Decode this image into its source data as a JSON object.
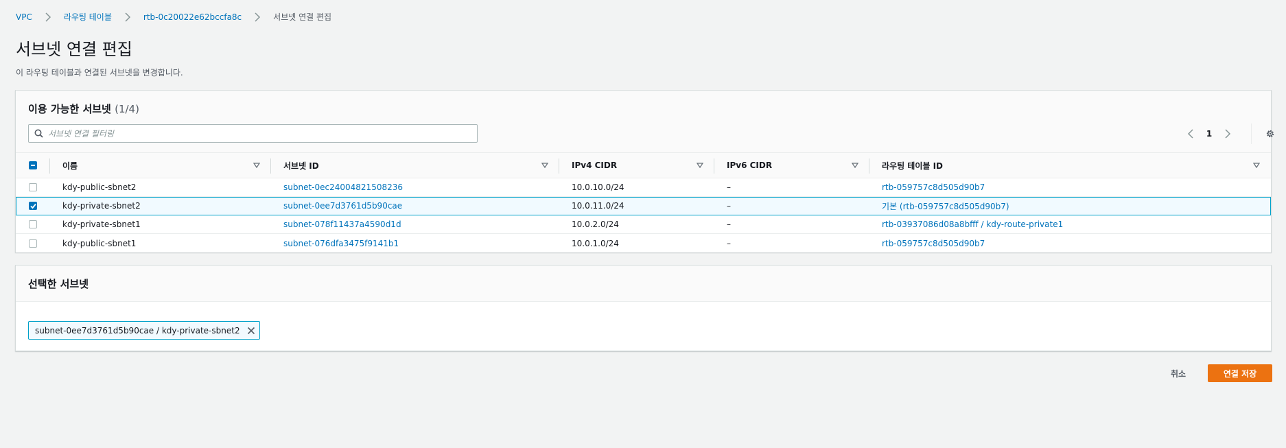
{
  "breadcrumb": {
    "items": [
      {
        "label": "VPC"
      },
      {
        "label": "라우팅 테이블"
      },
      {
        "label": "rtb-0c20022e62bccfa8c"
      },
      {
        "label": "서브넷 연결 편집"
      }
    ]
  },
  "page": {
    "title": "서브넷 연결 편집",
    "description": "이 라우팅 테이블과 연결된 서브넷을 변경합니다."
  },
  "available": {
    "title": "이용 가능한 서브넷",
    "count": "(1/4)",
    "search_placeholder": "서브넷 연결 필터링",
    "page_number": "1",
    "columns": {
      "name": "이름",
      "subnet_id": "서브넷 ID",
      "ipv4": "IPv4 CIDR",
      "ipv6": "IPv6 CIDR",
      "route_table": "라우팅 테이블 ID"
    },
    "rows": [
      {
        "name": "kdy-public-sbnet2",
        "subnet_id": "subnet-0ec24004821508236",
        "ipv4": "10.0.10.0/24",
        "ipv6": "–",
        "route_table": "rtb-059757c8d505d90b7",
        "checked": false
      },
      {
        "name": "kdy-private-sbnet2",
        "subnet_id": "subnet-0ee7d3761d5b90cae",
        "ipv4": "10.0.11.0/24",
        "ipv6": "–",
        "route_table": "기본 (rtb-059757c8d505d90b7)",
        "checked": true
      },
      {
        "name": "kdy-private-sbnet1",
        "subnet_id": "subnet-078f11437a4590d1d",
        "ipv4": "10.0.2.0/24",
        "ipv6": "–",
        "route_table": "rtb-03937086d08a8bfff / kdy-route-private1",
        "checked": false
      },
      {
        "name": "kdy-public-sbnet1",
        "subnet_id": "subnet-076dfa3475f9141b1",
        "ipv4": "10.0.1.0/24",
        "ipv6": "–",
        "route_table": "rtb-059757c8d505d90b7",
        "checked": false
      }
    ]
  },
  "selected": {
    "title": "선택한 서브넷",
    "token": "subnet-0ee7d3761d5b90cae / kdy-private-sbnet2"
  },
  "actions": {
    "cancel": "취소",
    "save": "연결 저장"
  },
  "colors": {
    "link": "#0073bb",
    "primary_button": "#ec7211",
    "selected_row_border": "#00a1c9"
  }
}
